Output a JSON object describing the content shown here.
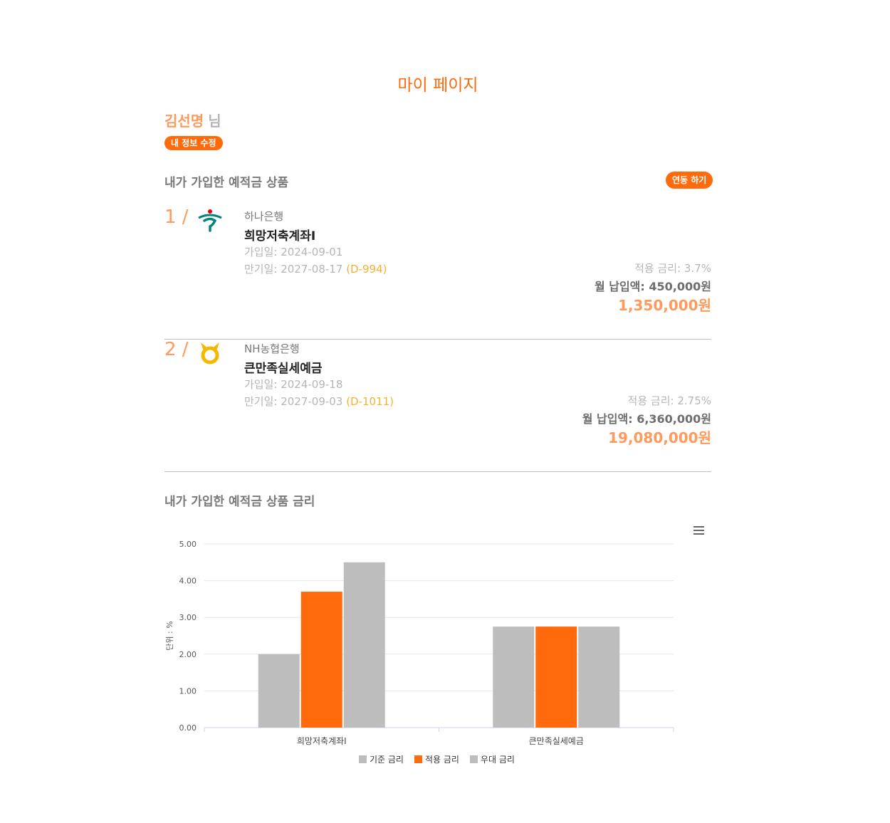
{
  "page": {
    "title": "마이 페이지"
  },
  "user": {
    "name": "김선명",
    "suffix": "님",
    "edit_label": "내 정보 수정"
  },
  "products_section": {
    "title": "내가 가입한 예적금 상품",
    "link_label": "연동 하기"
  },
  "products": [
    {
      "index": "1 /",
      "logo_icon": "hana-bank-logo-icon",
      "bank": "하나은행",
      "name": "희망저축계좌I",
      "join_date": "가입일: 2024-09-01",
      "maturity_date": "만기일: 2027-08-17",
      "d_day": "(D-994)",
      "rate": "적용 금리: 3.7%",
      "monthly_label": "월 납입액:",
      "monthly_value": "450,000원",
      "total": "1,350,000원"
    },
    {
      "index": "2 /",
      "logo_icon": "nh-bank-logo-icon",
      "bank": "NH농협은행",
      "name": "큰만족실세예금",
      "join_date": "가입일: 2024-09-18",
      "maturity_date": "만기일: 2027-09-03",
      "d_day": "(D-1011)",
      "rate": "적용 금리: 2.75%",
      "monthly_label": "월 납입액:",
      "monthly_value": "6,360,000원",
      "total": "19,080,000원"
    }
  ],
  "rates_section": {
    "title": "내가 가입한 예적금 상품 금리",
    "menu_icon": "hamburger-menu-icon"
  },
  "colors": {
    "accent": "#ff6a0c",
    "accent_light": "#ff9a5c",
    "dday": "#f5b12e",
    "gray_bar": "#bdbdbd"
  },
  "chart_data": {
    "type": "bar",
    "categories": [
      "희망저축계좌I",
      "큰만족실세예금"
    ],
    "series": [
      {
        "name": "기준 금리",
        "values": [
          2.0,
          2.75
        ],
        "color": "#bdbdbd"
      },
      {
        "name": "적용 금리",
        "values": [
          3.7,
          2.75
        ],
        "color": "#ff6a0c"
      },
      {
        "name": "우대 금리",
        "values": [
          4.5,
          2.75
        ],
        "color": "#bdbdbd"
      }
    ],
    "ylabel": "단위 : %",
    "ylim": [
      0,
      5
    ],
    "yticks": [
      "0.00",
      "1.00",
      "2.00",
      "3.00",
      "4.00",
      "5.00"
    ],
    "grid": true,
    "legend_position": "bottom"
  }
}
